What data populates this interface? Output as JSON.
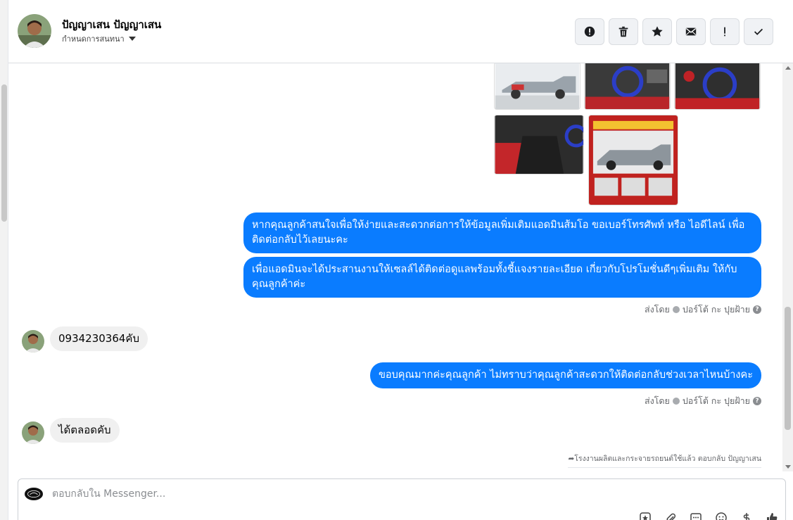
{
  "header": {
    "contact_name": "ปัญญาเสน ปัญญาเสน",
    "assign_label": "กำหนดการสนทนา",
    "actions": [
      {
        "name": "spam-button",
        "icon": "alert-circle-icon"
      },
      {
        "name": "delete-button",
        "icon": "trash-icon"
      },
      {
        "name": "star-button",
        "icon": "star-icon"
      },
      {
        "name": "mark-unread-button",
        "icon": "mail-icon"
      },
      {
        "name": "important-button",
        "icon": "exclamation-icon"
      },
      {
        "name": "done-button",
        "icon": "check-icon"
      }
    ]
  },
  "messages": {
    "outgoing_1": "หากคุณลูกค้าสนใจเพื่อให้ง่ายและสะดวกต่อการให้ข้อมูลเพิ่มเติมแอดมินส้มโอ ขอเบอร์โทรศัพท์ หรือ ไอดีไลน์ เพื่อติดต่อกลับไว้เลยนะคะ",
    "outgoing_2": "เพื่อแอดมินจะได้ประสานงานให้เซลล์ได้ติดต่อดูแลพร้อมทั้งชี้แจงรายละเอียด เกี่ยวกับโปรโมชั่นดีๆเพิ่มเติม ให้กับคุณลูกค้าค่ะ",
    "sent_by_1": "ส่งโดย",
    "sender_1": "ปอร์โต้ กะ ปุยฝ้าย",
    "incoming_1": "0934230364คับ",
    "outgoing_3": "ขอบคุณมากค่ะคุณลูกค้า ไม่ทราบว่าคุณลูกค้าสะดวกให้ติดต่อกลับช่วงเวลาไหนบ้างคะ",
    "sent_by_2": "ส่งโดย",
    "sender_2": "ปอร์โต้ กะ ปุยฝ้าย",
    "incoming_2": "ได้ตลอดคับ",
    "reply_note": "โรงงานผลิตและกระจายรถยนต์ใช้แล้ว ตอบกลับ ปัญญาเสน"
  },
  "composer": {
    "placeholder": "ตอบกลับใน Messenger..."
  },
  "colors": {
    "outgoing_bubble": "#0a7cff",
    "incoming_bubble": "#f0f0f0"
  }
}
